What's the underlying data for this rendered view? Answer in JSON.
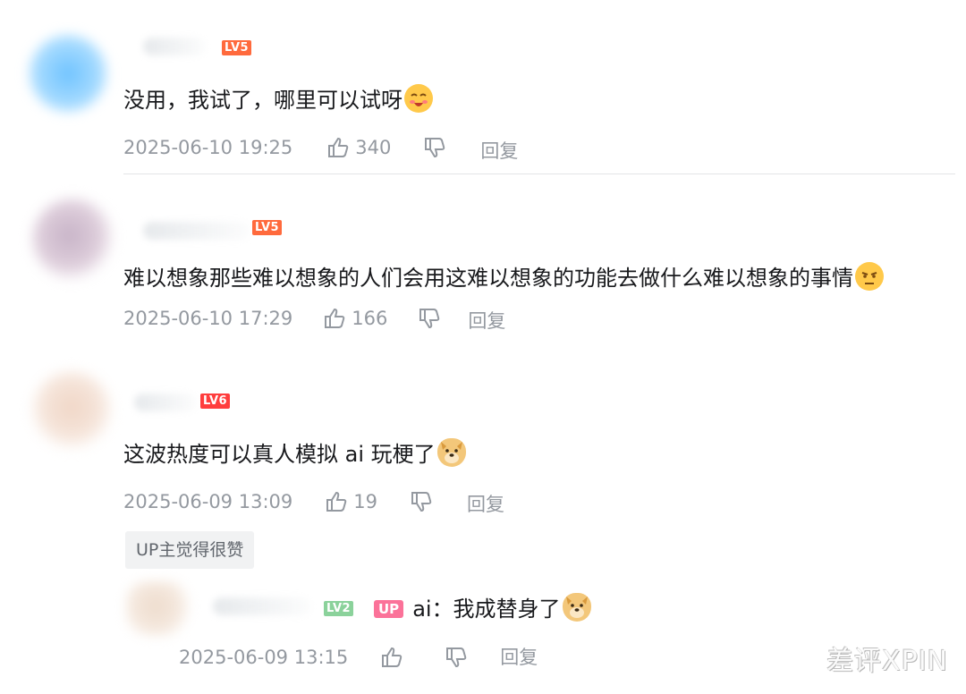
{
  "comments": [
    {
      "level": "LV5",
      "level_color": "#ff6a3d",
      "text": "没用，我试了，哪里可以试呀",
      "emoji": "blush-emoji",
      "date": "2025-06-10 19:25",
      "likes": "340",
      "reply_label": "回复"
    },
    {
      "level": "LV5",
      "level_color": "#ff6a3d",
      "text": "难以想象那些难以想象的人们会用这难以想象的功能去做什么难以想象的事情",
      "emoji": "thinking-emoji",
      "date": "2025-06-10 17:29",
      "likes": "166",
      "reply_label": "回复"
    },
    {
      "level": "LV6",
      "level_color": "#ff3d3d",
      "text": "这波热度可以真人模拟 ai 玩梗了",
      "emoji": "doge-emoji",
      "date": "2025-06-09 13:09",
      "likes": "19",
      "reply_label": "回复",
      "tag": "UP主觉得很赞"
    }
  ],
  "reply": {
    "level": "LV2",
    "level_color": "#8bd29b",
    "badge": "UP",
    "badge_color": "#fb7299",
    "text": "ai：我成替身了",
    "emoji": "doge-emoji",
    "date": "2025-06-09 13:15",
    "reply_label": "回复"
  },
  "watermark": "差评XPIN"
}
